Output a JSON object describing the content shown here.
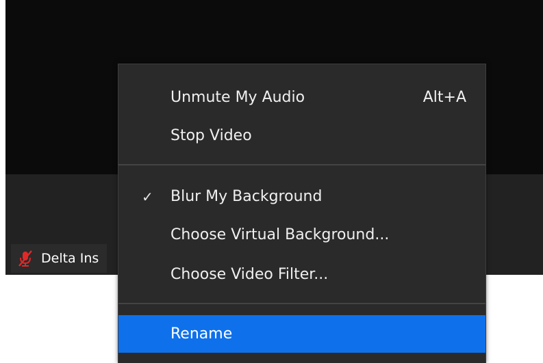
{
  "participant": {
    "name": "Delta Ins",
    "mic_icon": "mic-muted-icon",
    "mic_color": "#e02828"
  },
  "menu": {
    "items": [
      {
        "label": "Unmute My Audio",
        "shortcut": "Alt+A"
      },
      {
        "label": "Stop Video",
        "shortcut": ""
      },
      {
        "label": "Blur My Background",
        "shortcut": "",
        "check": "✓",
        "checked": true
      },
      {
        "label": "Choose Virtual Background...",
        "shortcut": ""
      },
      {
        "label": "Choose Video Filter...",
        "shortcut": ""
      },
      {
        "label": "Rename",
        "shortcut": "",
        "highlighted": true
      }
    ],
    "highlight_color": "#0e71eb"
  }
}
